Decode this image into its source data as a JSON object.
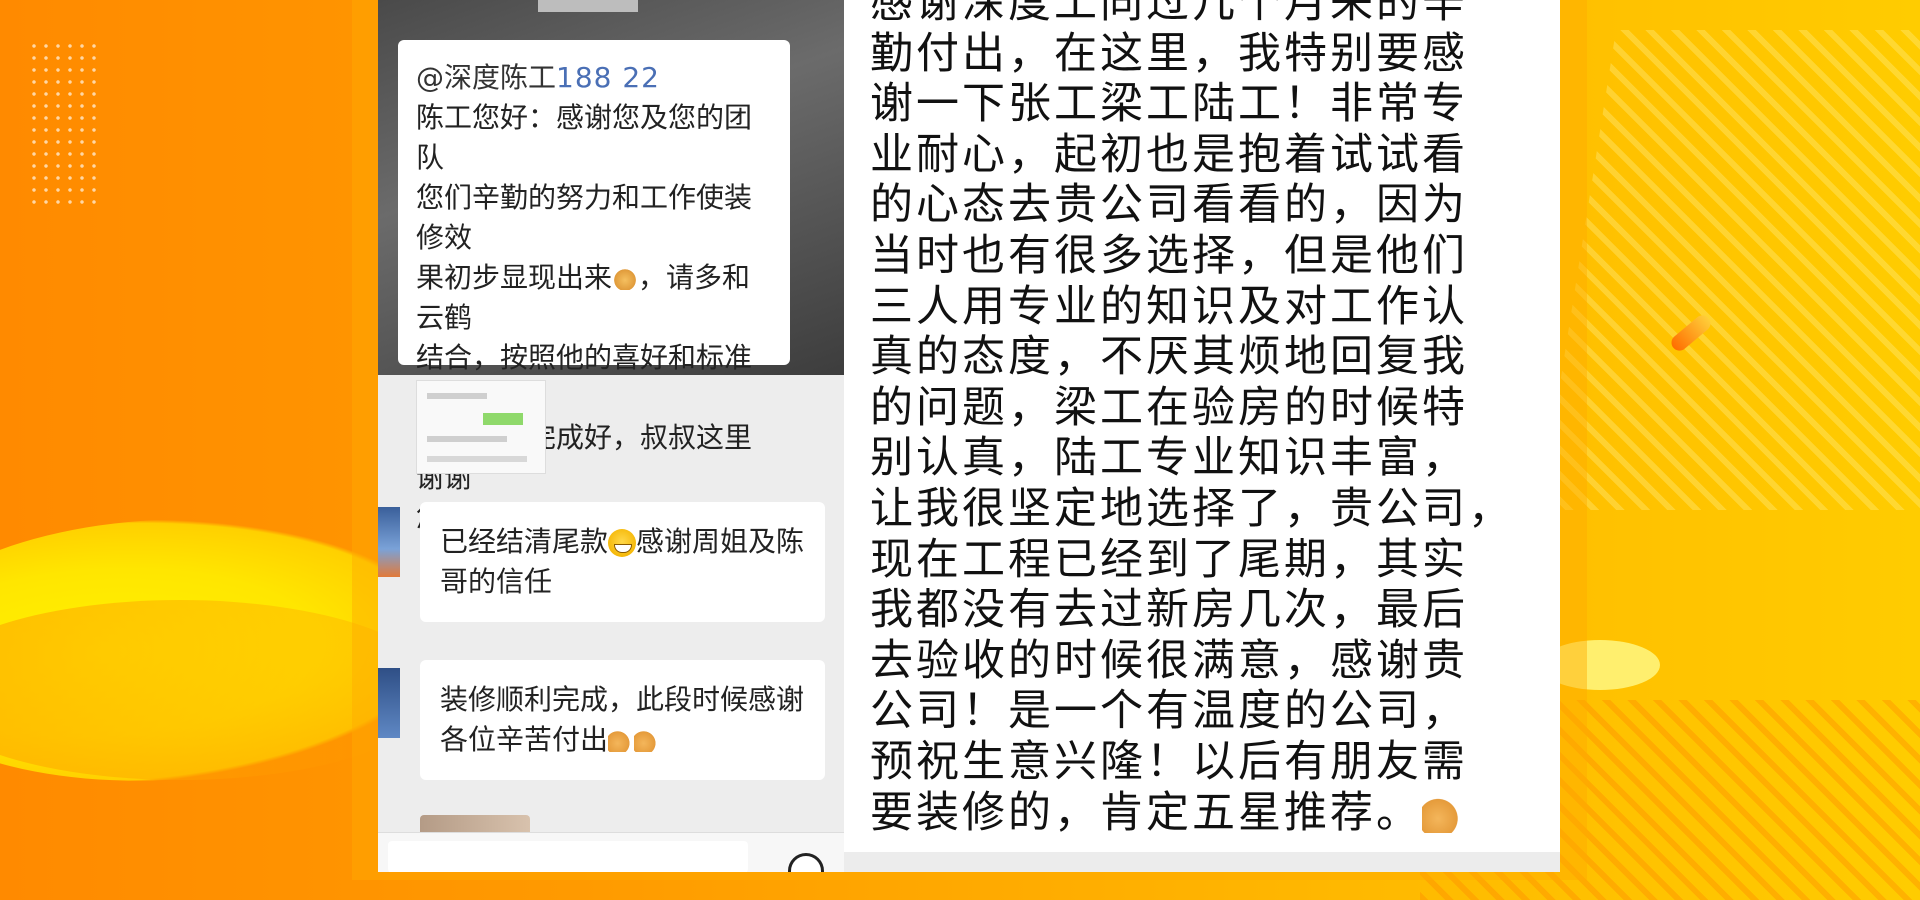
{
  "colors": {
    "bg_left": "#ff8a00",
    "bg_right": "#ffcc00",
    "link_blue": "#4a6fb5",
    "bubble_bg": "#ffffff",
    "chat_bg": "#ededed"
  },
  "left_chat": {
    "card": {
      "handle": "@深度陈工",
      "phone": "188       22",
      "lines": [
        "陈工您好：感谢您及您的团队",
        "您们辛勤的努力和工作使装修效",
        "果初步显现出来",
        "，请多和云鹤",
        "结合，按照他的喜好和标准把下",
        "步的施工完成好，叔叔这里谢谢",
        "您了"
      ]
    },
    "message_1": {
      "lines": [
        "已经结清尾款",
        "感谢周姐及陈",
        "哥的信任"
      ]
    },
    "message_2": {
      "lines": [
        "装修顺利完成，此段时候感谢",
        "各位辛苦付出"
      ]
    },
    "icons": {
      "hands": "folded-hands-icon",
      "handshake": "handshake-icon",
      "grin": "grinning-face-icon",
      "smiley": "smiley-face-icon"
    }
  },
  "right_review": {
    "lines": [
      "感谢深度工同过几个月来的辛",
      "勤付出，在这里，我特别要感",
      "谢一下张工梁工陆工！非常专",
      "业耐心，起初也是抱着试试看",
      "的心态去贵公司看看的，因为",
      "当时也有很多选择，但是他们",
      "三人用专业的知识及对工作认",
      "真的态度，不厌其烦地回复我",
      "的问题，梁工在验房的时候特",
      "别认真，陆工专业知识丰富，",
      "让我很坚定地选择了，贵公司，",
      "现在工程已经到了尾期，其实",
      "我都没有去过新房几次，最后",
      "去验收的时候很满意，感谢贵",
      "公司！是一个有温度的公司，",
      "预祝生意兴隆！以后有朋友需",
      "要装修的，肯定五星推荐。"
    ]
  }
}
